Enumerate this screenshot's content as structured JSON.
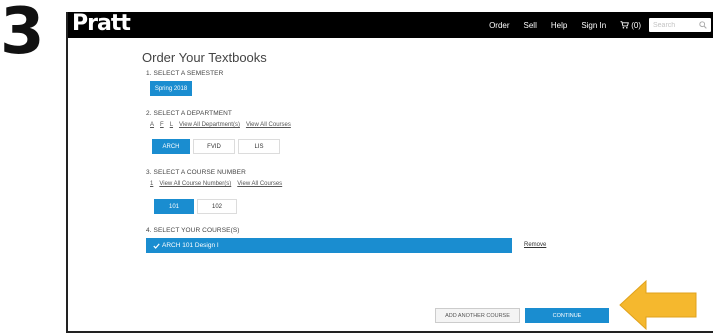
{
  "step_number": "3",
  "header": {
    "logo": "Pratt",
    "nav": [
      "Order",
      "Sell",
      "Help",
      "Sign In"
    ],
    "cart_label": "(0)",
    "search_placeholder": "Search"
  },
  "page_title": "Order Your Textbooks",
  "semester": {
    "label": "1. SELECT A SEMESTER",
    "options": [
      {
        "label": "Spring 2018",
        "selected": true
      }
    ]
  },
  "department": {
    "label": "2. SELECT A DEPARTMENT",
    "links": [
      "A",
      "F",
      "L",
      "View All Department(s)",
      "View All Courses"
    ],
    "options": [
      {
        "label": "ARCH",
        "selected": true
      },
      {
        "label": "FVID",
        "selected": false
      },
      {
        "label": "LIS",
        "selected": false
      }
    ]
  },
  "course_number": {
    "label": "3. SELECT A COURSE NUMBER",
    "links": [
      "1",
      "View All Course Number(s)",
      "View All Courses"
    ],
    "options": [
      {
        "label": "101",
        "selected": true
      },
      {
        "label": "102",
        "selected": false
      }
    ]
  },
  "courses": {
    "label": "4. SELECT YOUR COURSE(S)",
    "selected_course": "ARCH 101   Design I",
    "remove_label": "Remove"
  },
  "actions": {
    "add_another": "ADD ANOTHER COURSE",
    "continue": "CONTINUE"
  },
  "colors": {
    "accent": "#1a8dd0",
    "header_bg": "#000000",
    "arrow": "#f5b82e"
  },
  "icons": {
    "cart": "cart-icon",
    "search": "search-icon",
    "check": "check-icon",
    "arrow": "arrow-left-icon"
  }
}
